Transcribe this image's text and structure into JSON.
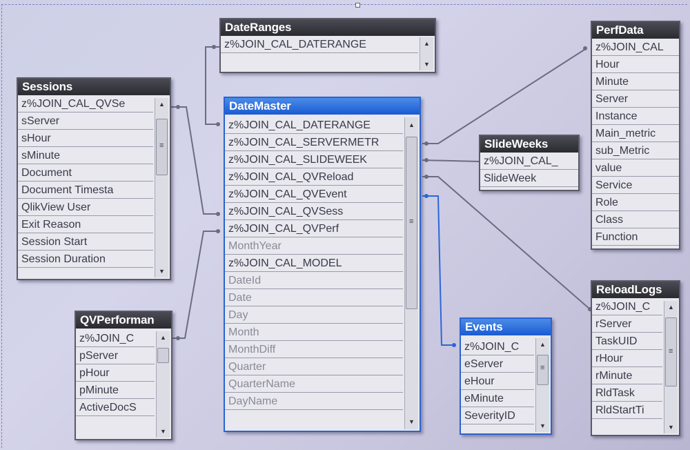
{
  "diagram": {
    "colors": {
      "link": "#6b6b82",
      "link_active": "#2b66d8",
      "title_bar": "#2e2e36",
      "title_active": "#2a66d6"
    },
    "tables": {
      "daterange": {
        "title": "DateRanges",
        "fields": [
          "z%JOIN_CAL_DATERANGE"
        ]
      },
      "sessions": {
        "title": "Sessions",
        "fields": [
          "z%JOIN_CAL_QVSe",
          "sServer",
          "sHour",
          "sMinute",
          "Document",
          "Document Timesta",
          "QlikView User",
          "Exit Reason",
          "Session Start",
          "Session Duration"
        ]
      },
      "datemaster": {
        "title": "DateMaster",
        "fields": [
          "z%JOIN_CAL_DATERANGE",
          "z%JOIN_CAL_SERVERMETR",
          "z%JOIN_CAL_SLIDEWEEK",
          "z%JOIN_CAL_QVReload",
          "z%JOIN_CAL_QVEvent",
          "z%JOIN_CAL_QVSess",
          "z%JOIN_CAL_QVPerf",
          "MonthYear",
          "z%JOIN_CAL_MODEL",
          "DateId",
          "Date",
          "Day",
          "Month",
          "MonthDiff",
          "Quarter",
          "QuarterName",
          "DayName"
        ]
      },
      "perfdata": {
        "title": "PerfData",
        "fields": [
          "z%JOIN_CAL",
          "Hour",
          "Minute",
          "Server",
          "Instance",
          "Main_metric",
          "sub_Metric",
          "value",
          "Service",
          "Role",
          "Class",
          "Function"
        ]
      },
      "slideweeks": {
        "title": "SlideWeeks",
        "fields": [
          "z%JOIN_CAL_",
          "SlideWeek"
        ]
      },
      "qvperf": {
        "title": "QVPerforman",
        "fields": [
          "z%JOIN_C",
          "pServer",
          "pHour",
          "pMinute",
          "ActiveDocS"
        ]
      },
      "events": {
        "title": "Events",
        "fields": [
          "z%JOIN_C",
          "eServer",
          "eHour",
          "eMinute",
          "SeverityID"
        ]
      },
      "reloadlogs": {
        "title": "ReloadLogs",
        "fields": [
          "z%JOIN_C",
          "rServer",
          "TaskUID",
          "rHour",
          "rMinute",
          "RldTask",
          "RldStartTi"
        ]
      }
    }
  }
}
